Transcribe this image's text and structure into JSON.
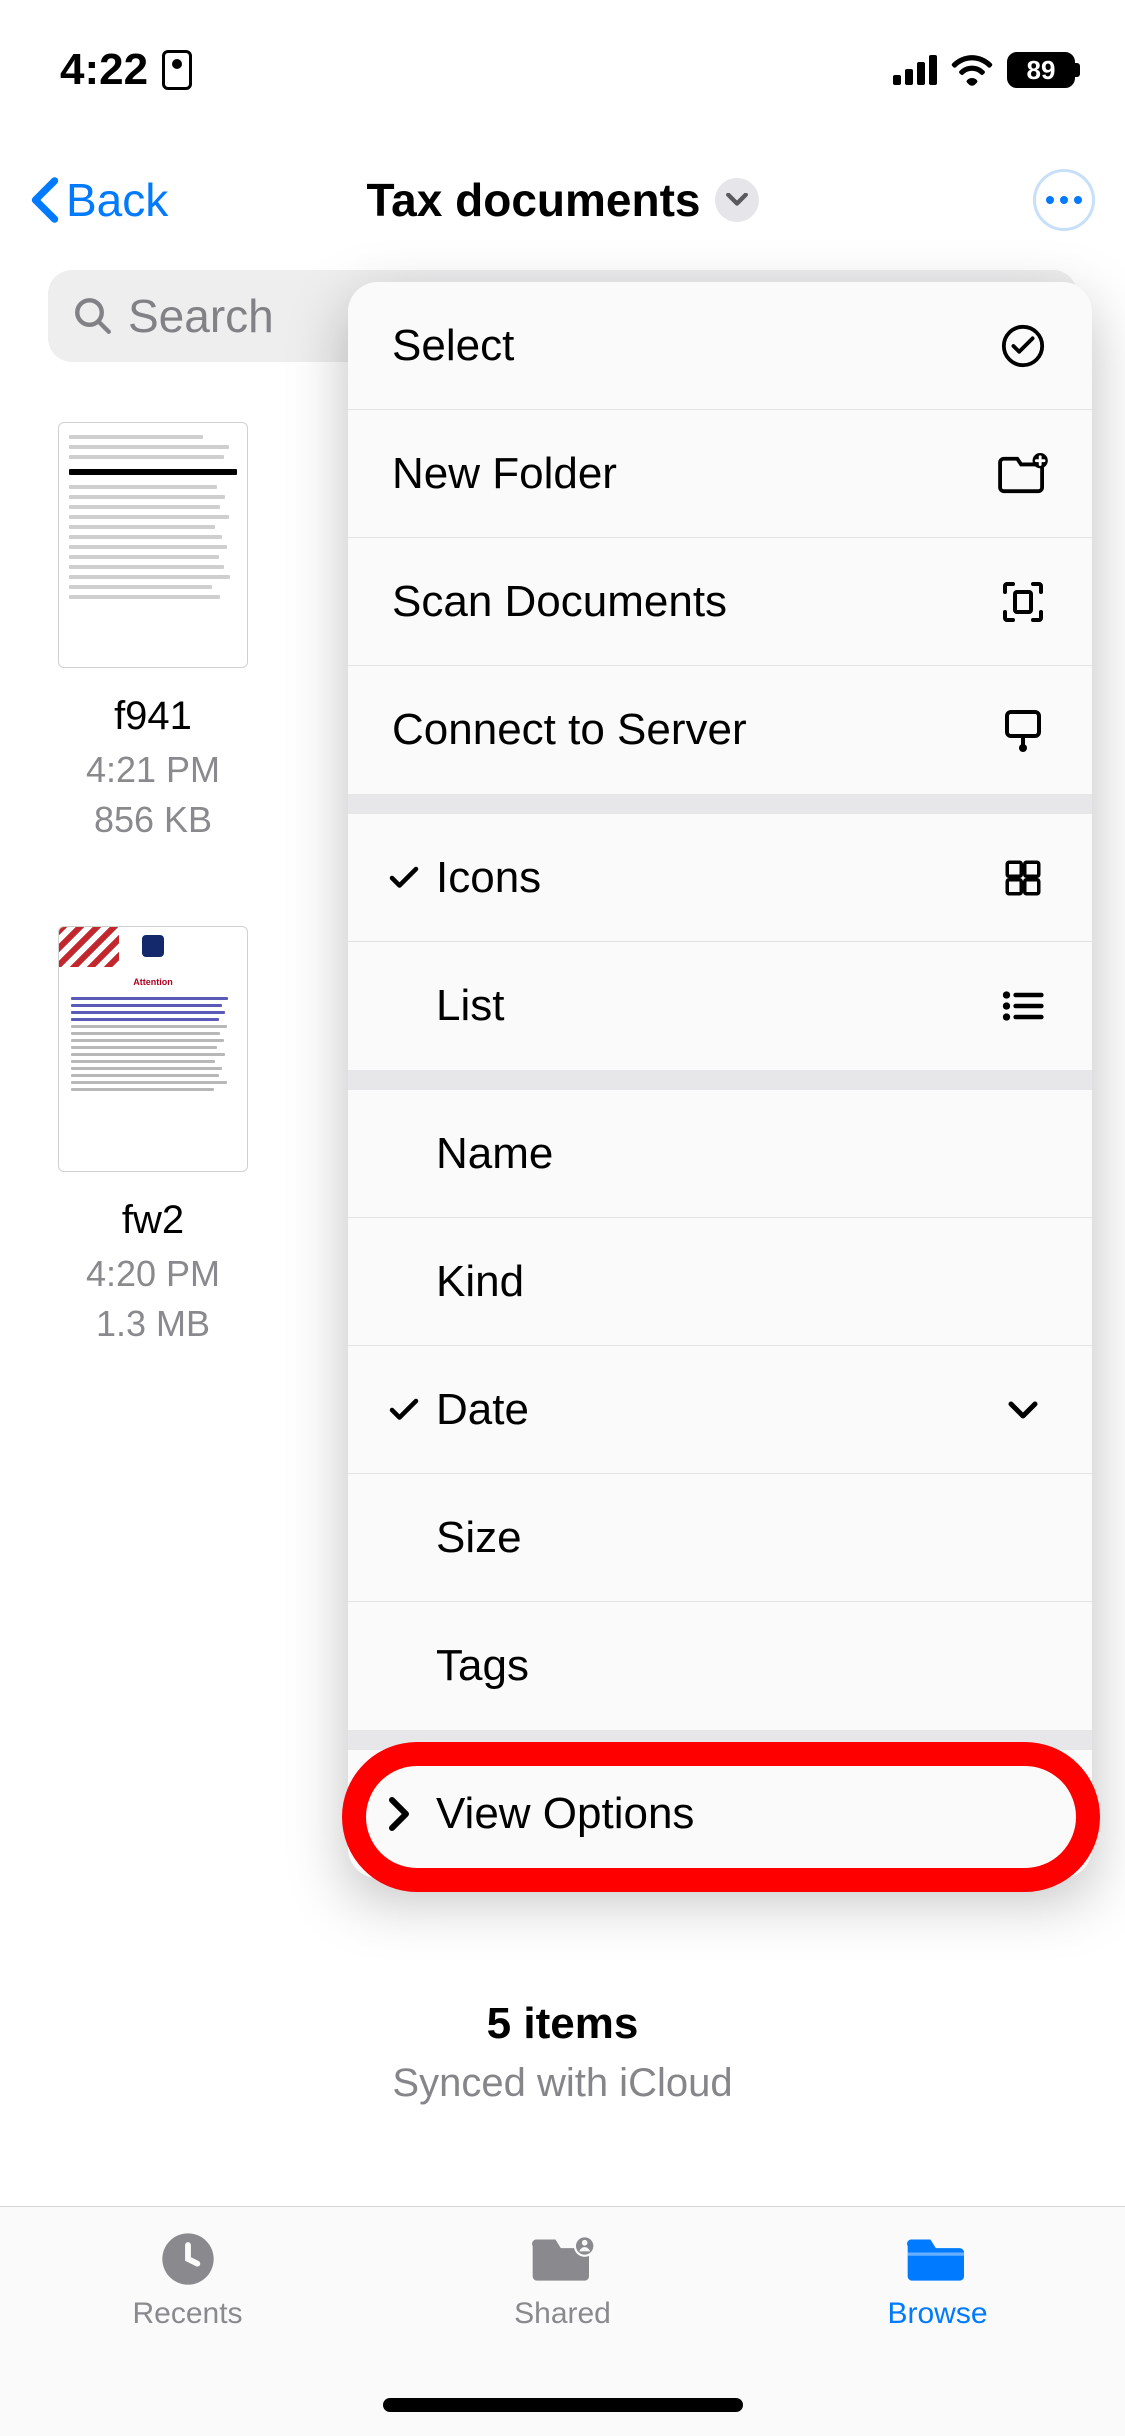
{
  "status": {
    "time": "4:22",
    "battery": "89"
  },
  "nav": {
    "back_label": "Back",
    "title": "Tax documents"
  },
  "search": {
    "placeholder": "Search"
  },
  "files": [
    {
      "name": "f941",
      "time": "4:21 PM",
      "size": "856 KB"
    },
    {
      "name": "fw2",
      "time": "4:20 PM",
      "size": "1.3 MB"
    }
  ],
  "menu": {
    "actions": {
      "select": "Select",
      "new_folder": "New Folder",
      "scan_documents": "Scan Documents",
      "connect_server": "Connect to Server"
    },
    "view_mode": {
      "icons": "Icons",
      "list": "List",
      "selected": "icons"
    },
    "sort": {
      "name": "Name",
      "kind": "Kind",
      "date": "Date",
      "size": "Size",
      "tags": "Tags",
      "selected": "date"
    },
    "view_options": "View Options"
  },
  "footer": {
    "count": "5 items",
    "sync": "Synced with iCloud"
  },
  "tabs": {
    "recents": "Recents",
    "shared": "Shared",
    "browse": "Browse"
  }
}
